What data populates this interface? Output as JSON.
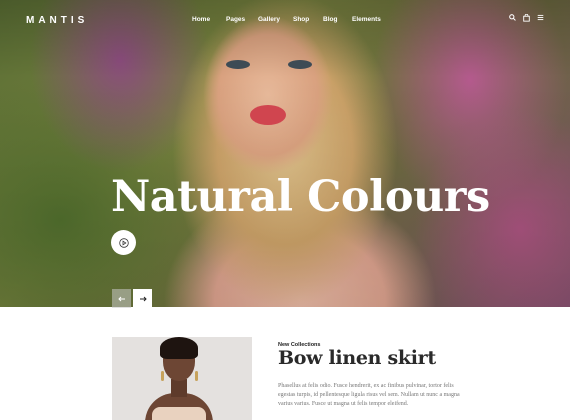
{
  "brand": {
    "logo": "MANTIS"
  },
  "nav": {
    "items": [
      {
        "label": "Home"
      },
      {
        "label": "Pages"
      },
      {
        "label": "Gallery"
      },
      {
        "label": "Shop"
      },
      {
        "label": "Blog"
      },
      {
        "label": "Elements"
      }
    ]
  },
  "header_icons": [
    "search-icon",
    "cart-icon",
    "menu-icon"
  ],
  "hero": {
    "headline": "Natural Colours",
    "play_icon": "play-icon",
    "prev_icon": "arrow-left-icon",
    "next_icon": "arrow-right-icon"
  },
  "collection": {
    "kicker": "New Collections",
    "title": "Bow linen skirt",
    "description": "Phasellus at felis odio. Fusce hendrerit, ex ac finibus pulvinar, tortor felis egestas turpis, id pellentesque ligula risus vel sem. Nullam ut nunc a magna varius varius. Fusce ut magna ut felis tempor eleifend."
  },
  "colors": {
    "accent": "#ffffff",
    "text_dark": "#2a2a2a",
    "text_muted": "#777777"
  }
}
